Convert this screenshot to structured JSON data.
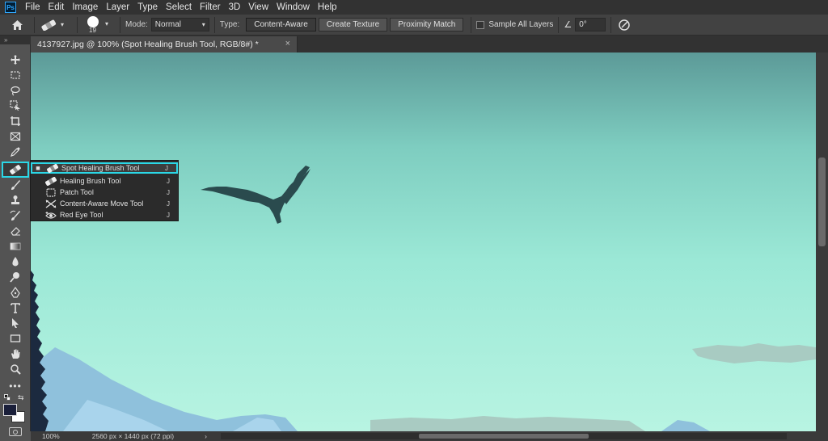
{
  "app": {
    "logo": "Ps"
  },
  "menu": [
    "File",
    "Edit",
    "Image",
    "Layer",
    "Type",
    "Select",
    "Filter",
    "3D",
    "View",
    "Window",
    "Help"
  ],
  "options": {
    "brush_size": "19",
    "mode_label": "Mode:",
    "mode_value": "Normal",
    "type_label": "Type:",
    "type_buttons": [
      "Content-Aware",
      "Create Texture",
      "Proximity Match"
    ],
    "sample_all_layers": "Sample All Layers",
    "angle_value": "0°"
  },
  "document": {
    "tab_title": "4137927.jpg @ 100% (Spot Healing Brush Tool, RGB/8#) *",
    "close_icon": "×"
  },
  "tool_flyout": [
    {
      "label": "Spot Healing Brush Tool",
      "shortcut": "J",
      "selected": true,
      "icon": "spot-healing-brush-icon"
    },
    {
      "label": "Healing Brush Tool",
      "shortcut": "J",
      "selected": false,
      "icon": "healing-brush-icon"
    },
    {
      "label": "Patch Tool",
      "shortcut": "J",
      "selected": false,
      "icon": "patch-icon"
    },
    {
      "label": "Content-Aware Move Tool",
      "shortcut": "J",
      "selected": false,
      "icon": "content-aware-move-icon"
    },
    {
      "label": "Red Eye Tool",
      "shortcut": "J",
      "selected": false,
      "icon": "red-eye-icon"
    }
  ],
  "status": {
    "zoom": "100%",
    "doc_info": "2560 px × 1440 px (72 ppi)"
  },
  "colors": {
    "accent": "#2bd7e6",
    "foreground_swatch": "#1a1f3a",
    "background_swatch": "#ffffff"
  }
}
